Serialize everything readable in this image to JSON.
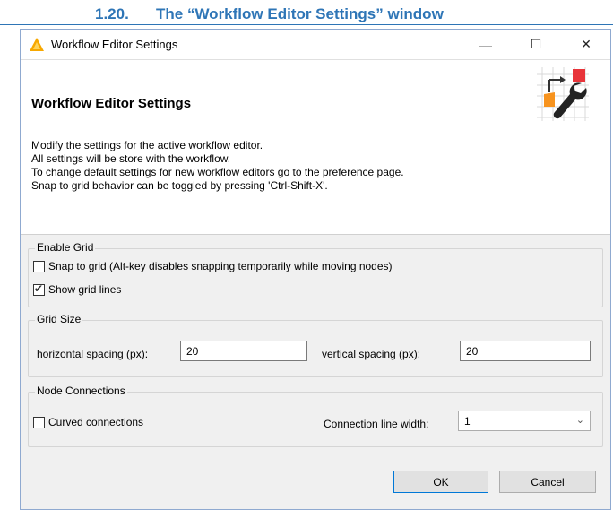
{
  "doc_heading": {
    "number": "1.20.",
    "title": "The “Workflow Editor Settings” window"
  },
  "window": {
    "title": "Workflow Editor Settings",
    "app_icon": "knime-triangle-icon",
    "controls": {
      "minimize": "—",
      "maximize": "☐",
      "close": "✕"
    }
  },
  "header": {
    "title": "Workflow Editor Settings",
    "icon": "workflow-settings-wrench-icon",
    "description": [
      "Modify the settings for the active workflow editor.",
      "All settings will be store with the workflow.",
      "To change default settings for new workflow editors go to the preference page.",
      "Snap to grid behavior can be toggled by pressing 'Ctrl-Shift-X'."
    ]
  },
  "enable_grid": {
    "label": "Enable Grid",
    "snap_to_grid": {
      "label": "Snap to grid (Alt-key disables snapping temporarily while moving nodes)",
      "checked": false
    },
    "show_grid_lines": {
      "label": "Show grid lines",
      "checked": true
    }
  },
  "grid_size": {
    "label": "Grid Size",
    "horizontal": {
      "label": "horizontal spacing (px):",
      "value": "20"
    },
    "vertical": {
      "label": "vertical spacing (px):",
      "value": "20"
    }
  },
  "node_connections": {
    "label": "Node Connections",
    "curved": {
      "label": "Curved connections",
      "checked": false
    },
    "line_width": {
      "label": "Connection line width:",
      "value": "1"
    }
  },
  "buttons": {
    "ok": "OK",
    "cancel": "Cancel"
  },
  "colors": {
    "heading_blue": "#2e75b6",
    "primary_border": "#0078d7",
    "knime_orange": "#f7a800"
  }
}
